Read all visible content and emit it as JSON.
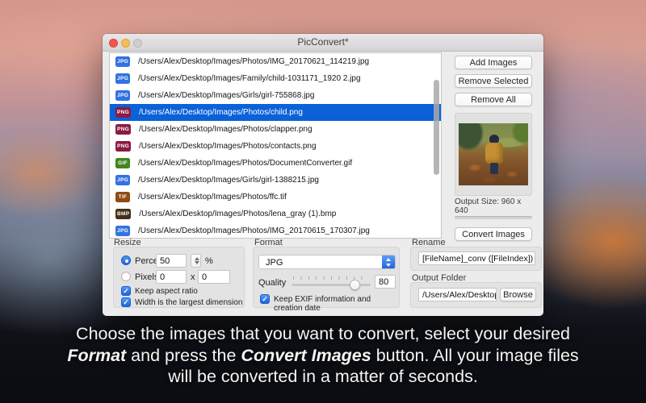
{
  "window": {
    "title": "PicConvert*",
    "selection_color": "#0a61d8",
    "badge_colors": {
      "JPG": "#3372e2",
      "PNG": "#8c1b44",
      "GIF": "#43861f",
      "TIF": "#8e4c12",
      "BMP": "#453019"
    },
    "file_list": [
      {
        "format": "JPG",
        "path": "/Users/Alex/Desktop/Images/Photos/IMG_20170621_114219.jpg",
        "selected": false
      },
      {
        "format": "JPG",
        "path": "/Users/Alex/Desktop/Images/Family/child-1031171_1920 2.jpg",
        "selected": false
      },
      {
        "format": "JPG",
        "path": "/Users/Alex/Desktop/Images/Girls/girl-755868.jpg",
        "selected": false
      },
      {
        "format": "PNG",
        "path": "/Users/Alex/Desktop/Images/Photos/child.png",
        "selected": true
      },
      {
        "format": "PNG",
        "path": "/Users/Alex/Desktop/Images/Photos/clapper.png",
        "selected": false
      },
      {
        "format": "PNG",
        "path": "/Users/Alex/Desktop/Images/Photos/contacts.png",
        "selected": false
      },
      {
        "format": "GIF",
        "path": "/Users/Alex/Desktop/Images/Photos/DocumentConverter.gif",
        "selected": false
      },
      {
        "format": "JPG",
        "path": "/Users/Alex/Desktop/Images/Girls/girl-1388215.jpg",
        "selected": false
      },
      {
        "format": "TIF",
        "path": "/Users/Alex/Desktop/Images/Photos/ffc.tif",
        "selected": false
      },
      {
        "format": "BMP",
        "path": "/Users/Alex/Desktop/Images/Photos/lena_gray (1).bmp",
        "selected": false
      },
      {
        "format": "JPG",
        "path": "/Users/Alex/Desktop/Images/Photos/IMG_20170615_170307.jpg",
        "selected": false
      }
    ],
    "buttons": {
      "add": "Add Images",
      "remove_selected": "Remove Selected",
      "remove_all": "Remove All",
      "convert": "Convert Images",
      "browse": "Browse"
    },
    "preview": {
      "output_size_label": "Output Size: 960 x 640",
      "progress_value": 0
    },
    "resize": {
      "label": "Resize",
      "percents_label": "Percents",
      "percents_value": "50",
      "percent_sign": "%",
      "pixels_label": "Pixels",
      "pixels_width": "0",
      "pixels_x": "x",
      "pixels_height": "0",
      "keep_aspect_label": "Keep aspect ratio",
      "largest_dim_label": "Width is the largest dimension",
      "mode": "percents"
    },
    "format": {
      "label": "Format",
      "selected_format": "JPG",
      "quality_label": "Quality",
      "quality_value": 80,
      "quality_min": 0,
      "quality_max": 100,
      "keep_exif_label": "Keep EXIF information and creation date"
    },
    "rename": {
      "label": "Rename",
      "pattern": "[FileName]_conv ([FileIndex])"
    },
    "output_folder": {
      "label": "Output Folder",
      "path": "/Users/Alex/Desktop"
    }
  },
  "caption": {
    "line1": "Choose the images that you want to convert, select your desired",
    "line2_bold1": "Format",
    "line2_mid": " and press the ",
    "line2_bold2": "Convert Images",
    "line2_end": " button. All your image files",
    "line3": "will be converted in a matter of seconds."
  },
  "checkmark": "✓"
}
